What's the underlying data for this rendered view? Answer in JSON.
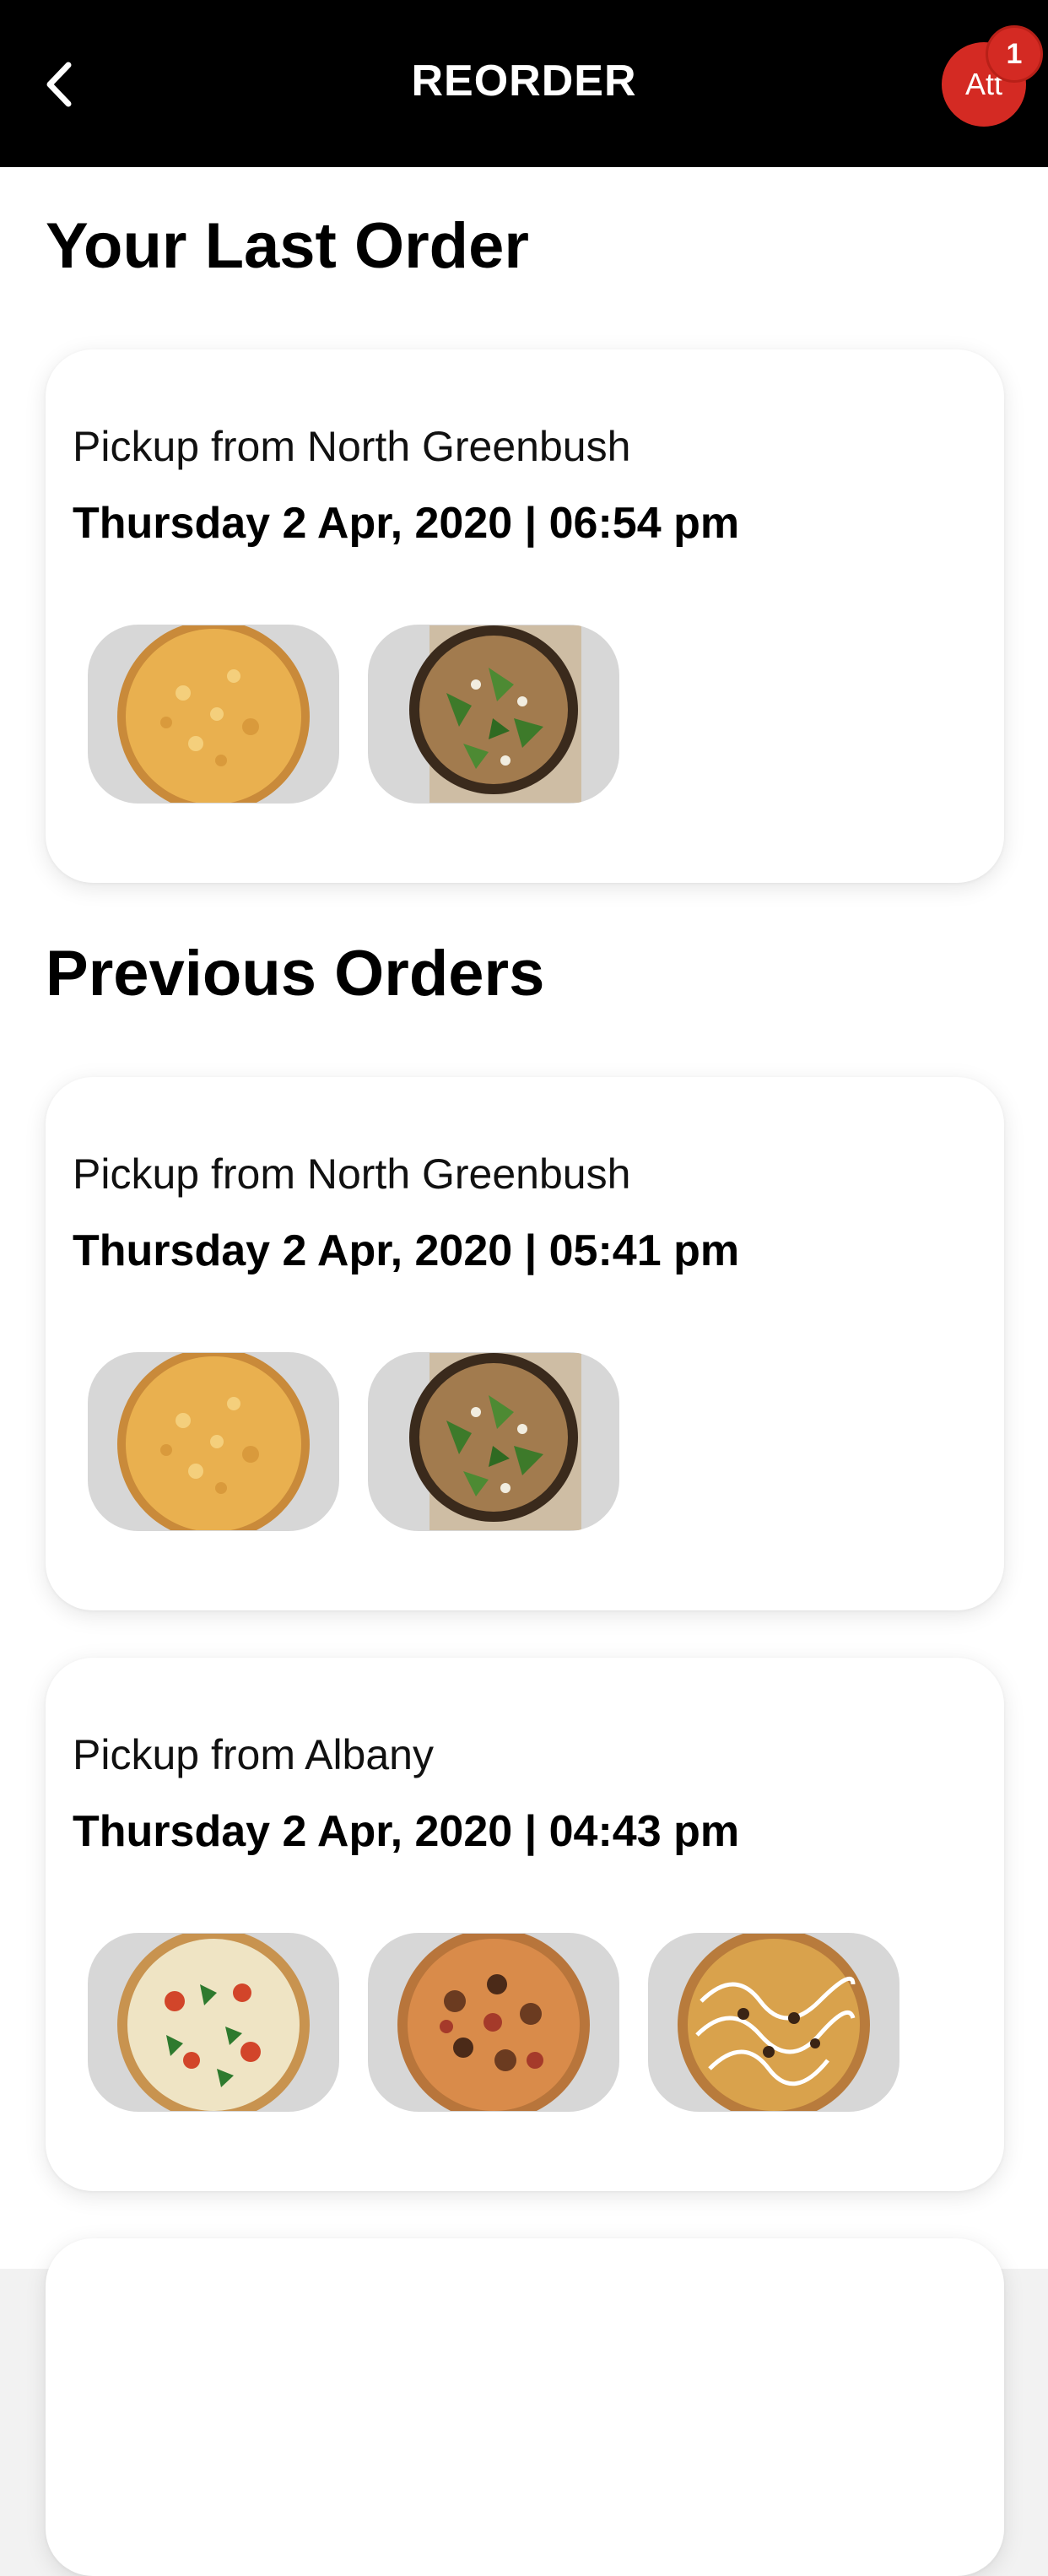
{
  "header": {
    "title": "REORDER",
    "avatar_initials": "Att",
    "cart_badge": "1",
    "bar_color": "#000000",
    "accent_color": "#d42a23"
  },
  "last_order": {
    "heading": "Your Last Order",
    "location": "Pickup from North Greenbush",
    "datetime": "Thursday 2 Apr, 2020 | 06:54 pm",
    "items": [
      "cheese-pizza-icon",
      "arugula-pizza-icon"
    ]
  },
  "previous_orders": {
    "heading": "Previous Orders",
    "orders": [
      {
        "location": "Pickup from North Greenbush",
        "datetime": "Thursday 2 Apr, 2020 | 05:41 pm",
        "items": [
          "cheese-pizza-icon",
          "arugula-pizza-icon"
        ]
      },
      {
        "location": "Pickup from Albany",
        "datetime": "Thursday 2 Apr, 2020 | 04:43 pm",
        "items": [
          "margherita-pizza-icon",
          "meat-pizza-icon",
          "drizzle-pizza-icon"
        ]
      }
    ]
  }
}
